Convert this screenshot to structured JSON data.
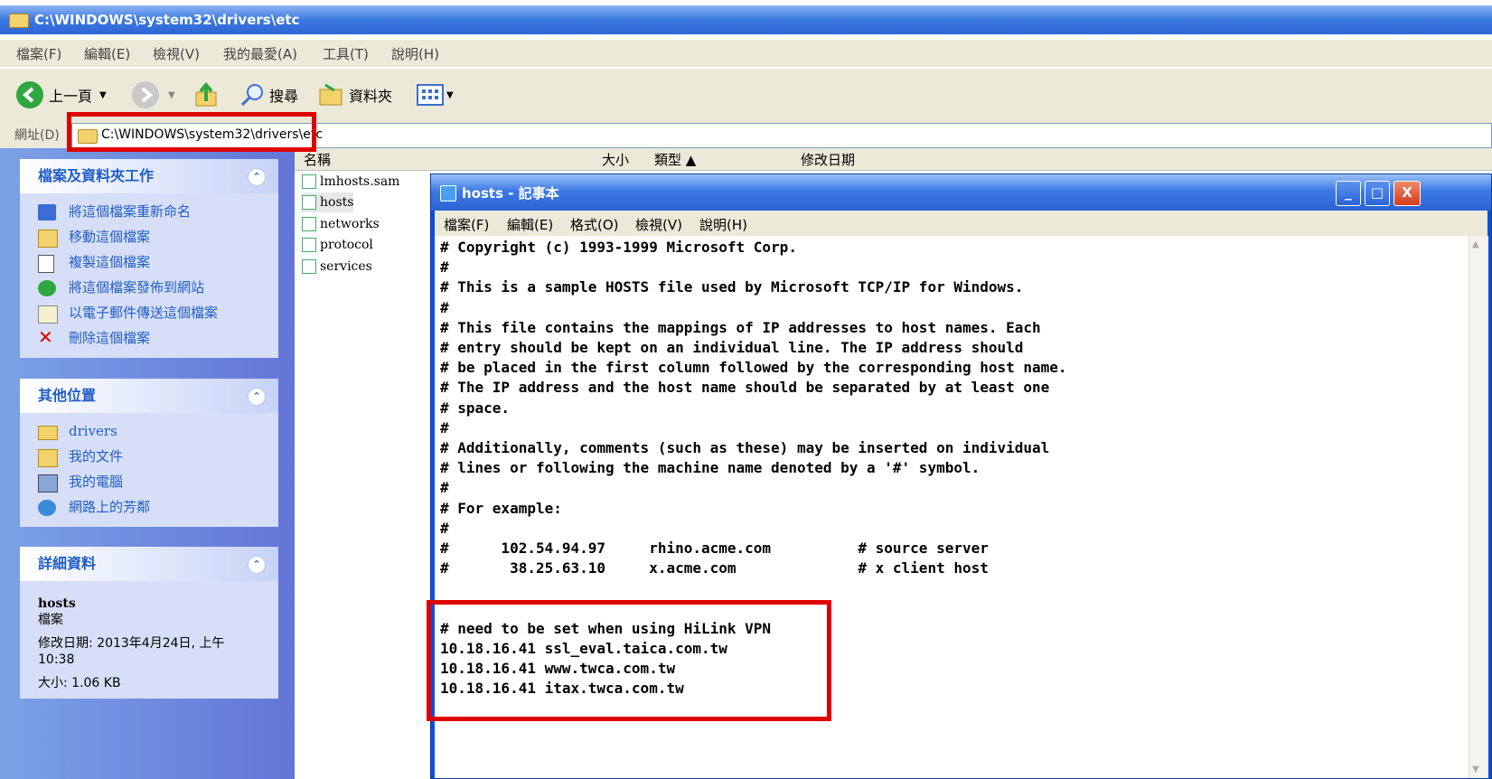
{
  "explorer": {
    "title": "C:\\WINDOWS\\system32\\drivers\\etc",
    "menu": [
      "檔案(F)",
      "編輯(E)",
      "檢視(V)",
      "我的最愛(A)",
      "工具(T)",
      "說明(H)"
    ],
    "toolbar": {
      "back": "上一頁",
      "search": "搜尋",
      "folders": "資料夾"
    },
    "address_label": "網址(D)",
    "address_value": "C:\\WINDOWS\\system32\\drivers\\etc"
  },
  "sidebar": {
    "tasks_title": "檔案及資料夾工作",
    "tasks": [
      {
        "label": "將這個檔案重新命名",
        "icon": "rename-icon"
      },
      {
        "label": "移動這個檔案",
        "icon": "move-icon"
      },
      {
        "label": "複製這個檔案",
        "icon": "copy-icon"
      },
      {
        "label": "將這個檔案發佈到網站",
        "icon": "publish-web-icon"
      },
      {
        "label": "以電子郵件傳送這個檔案",
        "icon": "email-icon"
      },
      {
        "label": "刪除這個檔案",
        "icon": "delete-icon"
      }
    ],
    "places_title": "其他位置",
    "places": [
      {
        "label": "drivers",
        "icon": "folder-icon"
      },
      {
        "label": "我的文件",
        "icon": "my-documents-icon"
      },
      {
        "label": "我的電腦",
        "icon": "my-computer-icon"
      },
      {
        "label": "網路上的芳鄰",
        "icon": "network-places-icon"
      }
    ],
    "details_title": "詳細資料",
    "details": {
      "name": "hosts",
      "type": "檔案",
      "modified_line1": "修改日期: 2013年4月24日, 上午",
      "modified_line2": "10:38",
      "size": "大小: 1.06 KB"
    }
  },
  "file_list": {
    "columns": [
      "名稱",
      "大小",
      "類型 ▲",
      "修改日期"
    ],
    "files": [
      "lmhosts.sam",
      "hosts",
      "networks",
      "protocol",
      "services"
    ]
  },
  "notepad": {
    "title": "hosts - 記事本",
    "menu": [
      "檔案(F)",
      "編輯(E)",
      "格式(O)",
      "檢視(V)",
      "說明(H)"
    ],
    "buttons": {
      "minimize": "_",
      "maximize": "□",
      "close": "X"
    },
    "content": "# Copyright (c) 1993-1999 Microsoft Corp.\n#\n# This is a sample HOSTS file used by Microsoft TCP/IP for Windows.\n#\n# This file contains the mappings of IP addresses to host names. Each\n# entry should be kept on an individual line. The IP address should\n# be placed in the first column followed by the corresponding host name.\n# The IP address and the host name should be separated by at least one\n# space.\n#\n# Additionally, comments (such as these) may be inserted on individual\n# lines or following the machine name denoted by a '#' symbol.\n#\n# For example:\n#\n#      102.54.94.97     rhino.acme.com          # source server\n#       38.25.63.10     x.acme.com              # x client host\n\n\n# need to be set when using HiLink VPN\n10.18.16.41 ssl_eval.taica.com.tw\n10.18.16.41 www.twca.com.tw\n10.18.16.41 itax.twca.com.tw"
  },
  "colors": {
    "highlight": "#e00000",
    "title_blue": "#2f66d6",
    "task_blue": "#215dc6"
  }
}
